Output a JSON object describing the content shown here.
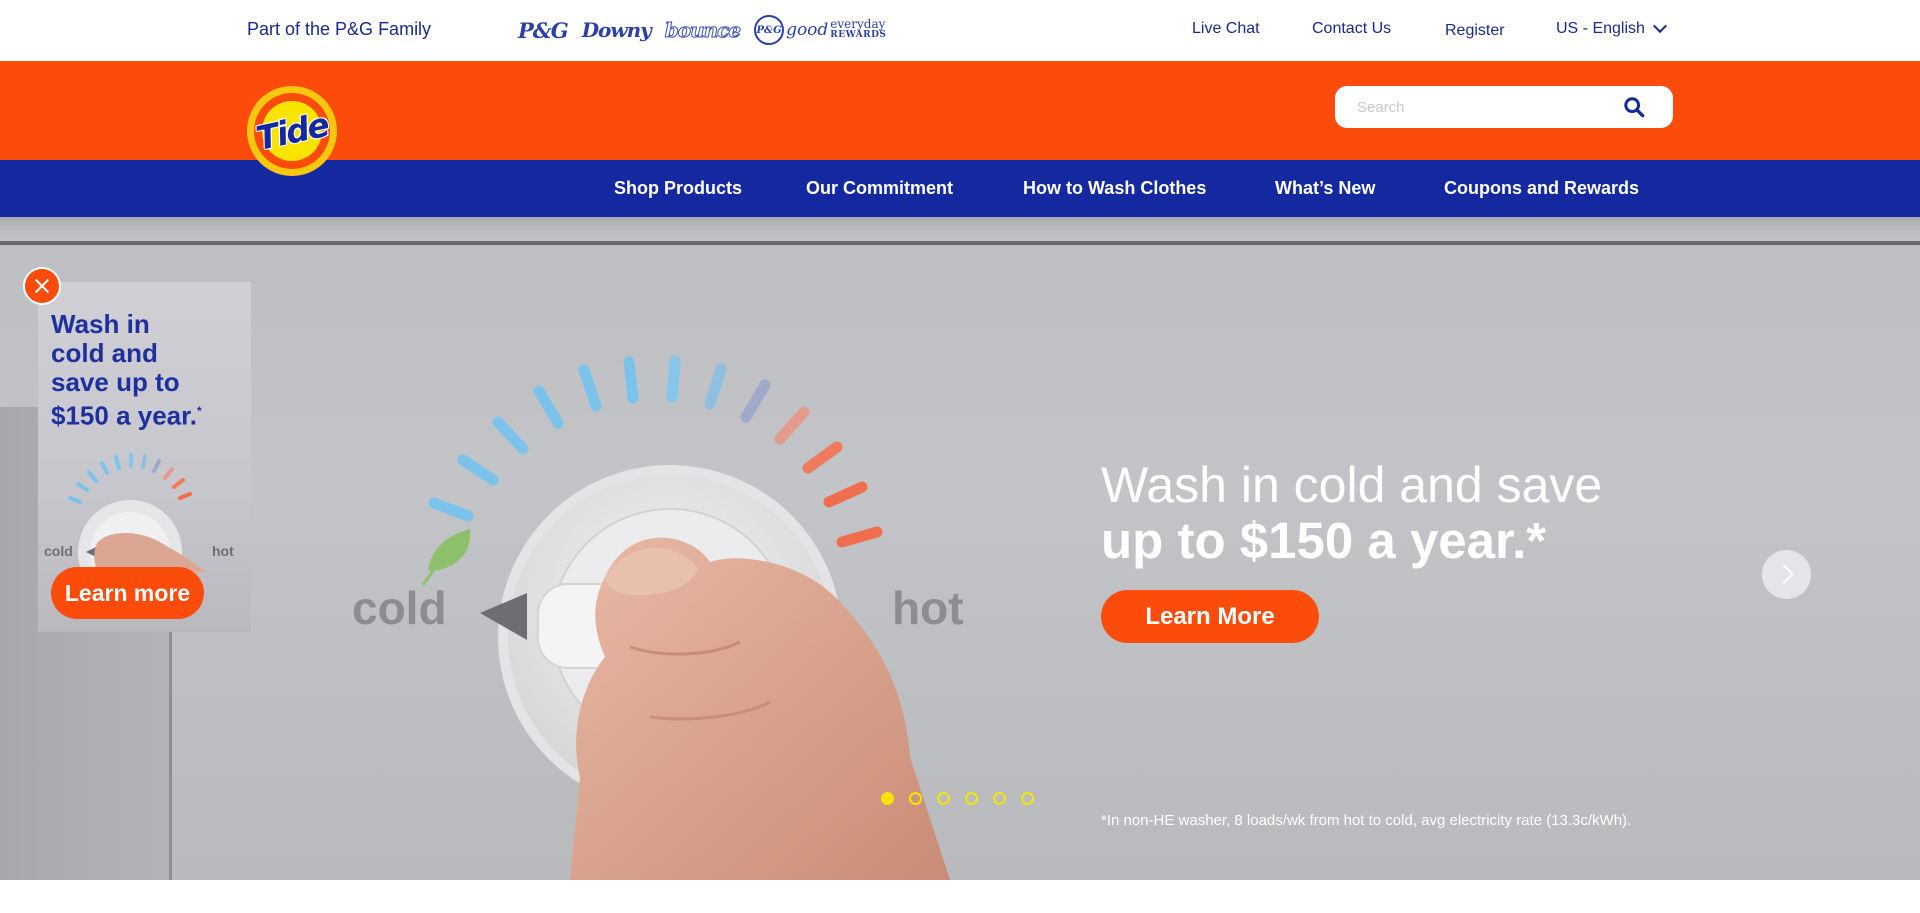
{
  "topbar": {
    "family_text": "Part of the P&G Family",
    "brands": {
      "pg": "P&G",
      "downy": "Downy",
      "bounce": "bounce",
      "good_pg": "P&G",
      "good_main": "good",
      "good_everyday": "everyday",
      "good_rewards": "REWARDS"
    },
    "links": {
      "live_chat": "Live Chat",
      "contact_us": "Contact Us",
      "register": "Register",
      "language": "US - English"
    }
  },
  "header": {
    "logo_text": "Tide",
    "search": {
      "placeholder": "Search",
      "value": ""
    }
  },
  "nav": {
    "items": [
      "Shop Products",
      "Our Commitment",
      "How to Wash Clothes",
      "What’s New",
      "Coupons and Rewards"
    ]
  },
  "hero": {
    "headline_line1": "Wash in cold and save",
    "headline_line2": "up to $150 a year.*",
    "cta_label": "Learn More",
    "dial_cold_label": "cold",
    "dial_hot_label": "hot",
    "disclaimer": "*In non-HE washer, 8 loads/wk from hot to cold, avg electricity rate (13.3c/kWh).",
    "slide_count": 6,
    "active_slide": 1
  },
  "promo": {
    "line1": "Wash in",
    "line2": "cold and",
    "line3": "save up to",
    "line4": "$150 a year.",
    "asterisk": "*",
    "cold_label": "cold",
    "hot_label": "hot",
    "button_label": "Learn more"
  },
  "colors": {
    "orange": "#fb4c0b",
    "nav_blue": "#1428a0",
    "brand_text_blue": "#1a2a8c",
    "carousel_dot_yellow": "#f5e400"
  },
  "icons": {
    "search": "search-icon",
    "language_dropdown": "chevron-down-icon",
    "carousel_next": "chevron-right-icon",
    "promo_close": "close-icon"
  }
}
